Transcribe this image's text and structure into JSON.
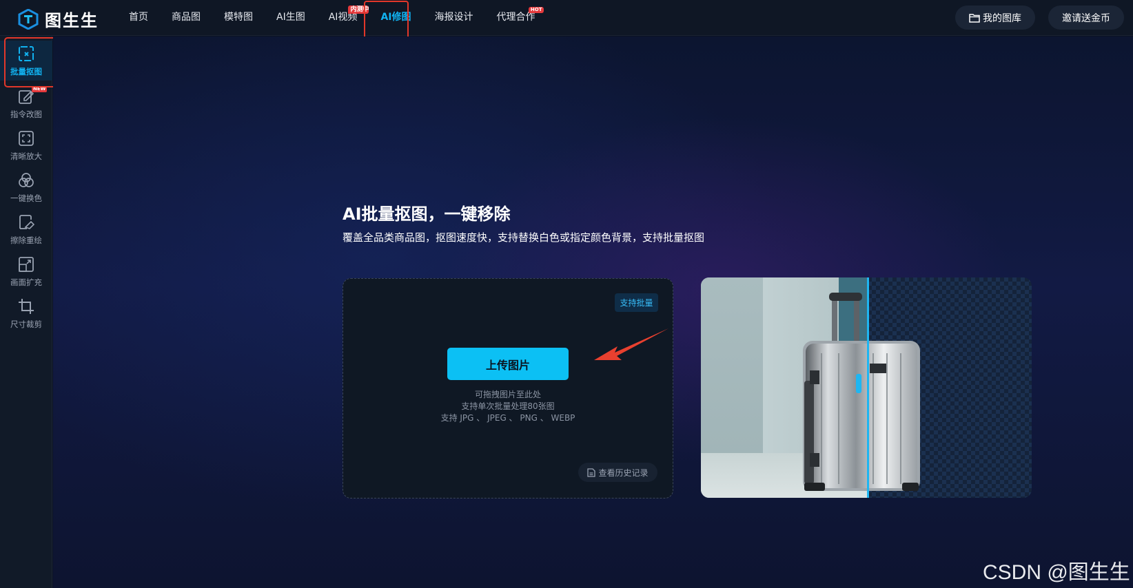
{
  "brand": {
    "name": "图生生",
    "accent": "#11b2f0"
  },
  "nav": {
    "items": [
      {
        "label": "首页"
      },
      {
        "label": "商品图"
      },
      {
        "label": "模特图"
      },
      {
        "label": "AI生图"
      },
      {
        "label": "AI视频",
        "badge": "内测中"
      },
      {
        "label": "AI修图",
        "active": true
      },
      {
        "label": "海报设计"
      },
      {
        "label": "代理合作",
        "badge": "HOT"
      }
    ],
    "my_library": "我的图库",
    "invite": "邀请送金币"
  },
  "sidebar": {
    "items": [
      {
        "label": "批量抠图",
        "icon": "cutout-icon",
        "active": true
      },
      {
        "label": "指令改图",
        "icon": "edit-icon",
        "badge": "NEW"
      },
      {
        "label": "清晰放大",
        "icon": "enlarge-icon"
      },
      {
        "label": "一键换色",
        "icon": "color-icon"
      },
      {
        "label": "擦除重绘",
        "icon": "eraser-icon"
      },
      {
        "label": "画面扩充",
        "icon": "expand-icon"
      },
      {
        "label": "尺寸裁剪",
        "icon": "crop-icon"
      }
    ]
  },
  "hero": {
    "title": "AI批量抠图，一键移除",
    "subtitle": "覆盖全品类商品图，抠图速度快，支持替换白色或指定颜色背景，支持批量抠图"
  },
  "upload": {
    "tag": "支持批量",
    "button": "上传图片",
    "hints": [
      "可拖拽图片至此处",
      "支持单次批量处理80张图",
      "支持 JPG 、 JPEG 、 PNG 、 WEBP"
    ],
    "history": "查看历史记录"
  },
  "watermark": "CSDN @图生生"
}
